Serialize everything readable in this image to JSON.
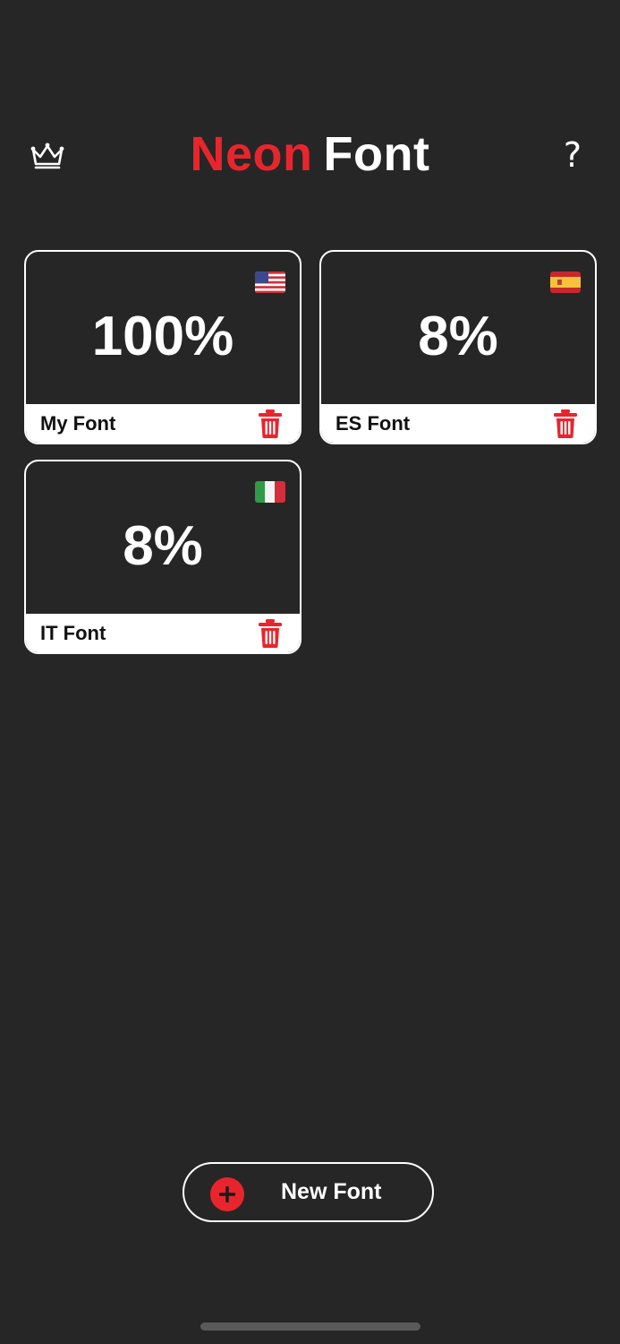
{
  "header": {
    "title_part1": "Neon",
    "title_part2": "Font",
    "help_label": "?",
    "premium_icon": "crown-icon"
  },
  "colors": {
    "background": "#262626",
    "accent": "#e8252d",
    "text": "#ffffff"
  },
  "fonts": [
    {
      "percent": "100%",
      "name": "My Font",
      "flag": "us-flag-icon"
    },
    {
      "percent": "8%",
      "name": "ES Font",
      "flag": "es-flag-icon"
    },
    {
      "percent": "8%",
      "name": "IT Font",
      "flag": "it-flag-icon"
    }
  ],
  "actions": {
    "new_font_label": "New Font",
    "delete_icon": "trash-icon",
    "add_icon": "plus-icon"
  }
}
